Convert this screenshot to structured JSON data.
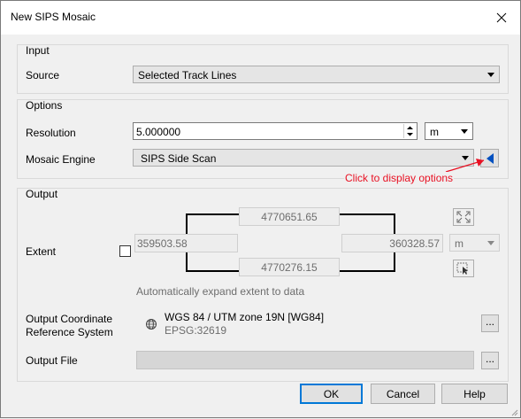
{
  "window": {
    "title": "New SIPS Mosaic"
  },
  "input": {
    "group_label": "Input",
    "source_label": "Source",
    "source_value": "Selected Track Lines"
  },
  "options": {
    "group_label": "Options",
    "resolution_label": "Resolution",
    "resolution_value": "5.000000",
    "resolution_unit": "m",
    "engine_label": "Mosaic Engine",
    "engine_value": "SIPS Side Scan",
    "annotation": "Click to display options"
  },
  "output": {
    "group_label": "Output",
    "extent_label": "Extent",
    "extent_top": "4770651.65",
    "extent_left": "359503.58",
    "extent_right": "360328.57",
    "extent_bottom": "4770276.15",
    "extent_unit": "m",
    "auto_expand_note": "Automatically expand extent to data",
    "crs_label_line1": "Output Coordinate",
    "crs_label_line2": "Reference System",
    "crs_name": "WGS 84 / UTM zone 19N [WG84]",
    "crs_epsg": "EPSG:32619",
    "file_label": "Output File",
    "file_value": "",
    "browse_label": "..."
  },
  "footer": {
    "ok": "OK",
    "cancel": "Cancel",
    "help": "Help"
  },
  "colors": {
    "annotation": "#e81123",
    "accent": "#0078d7"
  }
}
